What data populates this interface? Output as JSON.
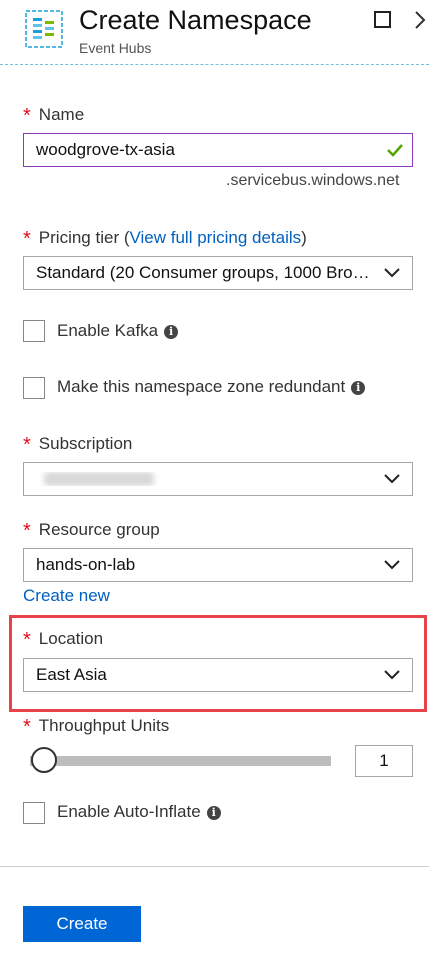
{
  "header": {
    "title": "Create Namespace",
    "subtitle": "Event Hubs",
    "icon": "event-hubs-icon",
    "accent_color": "#1aa0d8"
  },
  "name_field": {
    "label": "Name",
    "value": "woodgrove-tx-asia",
    "suffix": ".servicebus.windows.net",
    "valid_color": "#57a300"
  },
  "pricing": {
    "label": "Pricing tier (",
    "link": "View full pricing details",
    "label_end": ")",
    "value": "Standard (20 Consumer groups, 1000 Brok..."
  },
  "enable_kafka": {
    "label": "Enable Kafka",
    "checked": false
  },
  "zone_redundant": {
    "label": "Make this namespace zone redundant",
    "checked": false
  },
  "subscription": {
    "label": "Subscription",
    "value_hidden": true
  },
  "resource_group": {
    "label": "Resource group",
    "value": "hands-on-lab",
    "create_new": "Create new"
  },
  "location": {
    "label": "Location",
    "value": "East Asia",
    "highlight_color": "#e8434b"
  },
  "throughput": {
    "label": "Throughput Units",
    "value": "1",
    "slider_fraction": 0.0
  },
  "auto_inflate": {
    "label": "Enable Auto-Inflate",
    "checked": false
  },
  "actions": {
    "create_label": "Create",
    "primary_color": "#0066d6"
  },
  "required_marker": "*"
}
